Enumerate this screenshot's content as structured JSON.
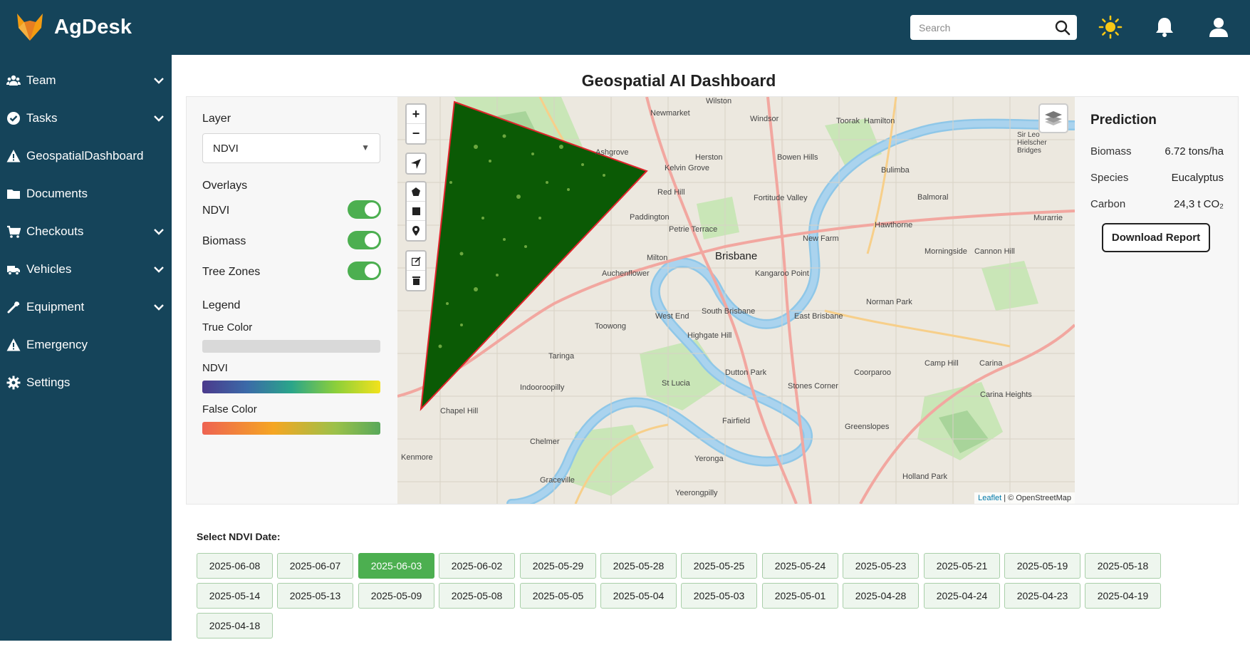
{
  "app": {
    "name": "AgDesk"
  },
  "header": {
    "search_placeholder": "Search",
    "icons": [
      "search-icon",
      "sun-icon",
      "bell-icon",
      "user-icon"
    ]
  },
  "sidebar": {
    "items": [
      {
        "label": "Team",
        "icon": "users-icon",
        "has_submenu": true
      },
      {
        "label": "Tasks",
        "icon": "check-circle-icon",
        "has_submenu": true
      },
      {
        "label": "GeospatialDashboard",
        "icon": "warning-icon",
        "has_submenu": false
      },
      {
        "label": "Documents",
        "icon": "folder-icon",
        "has_submenu": false
      },
      {
        "label": "Checkouts",
        "icon": "cart-icon",
        "has_submenu": true
      },
      {
        "label": "Vehicles",
        "icon": "truck-icon",
        "has_submenu": true
      },
      {
        "label": "Equipment",
        "icon": "wrench-icon",
        "has_submenu": true
      },
      {
        "label": "Emergency",
        "icon": "warning-icon",
        "has_submenu": false
      },
      {
        "label": "Settings",
        "icon": "gear-icon",
        "has_submenu": false
      }
    ]
  },
  "main": {
    "title": "Geospatial AI Dashboard"
  },
  "controls": {
    "layer_label": "Layer",
    "layer_value": "NDVI",
    "overlays_label": "Overlays",
    "overlays": [
      {
        "label": "NDVI",
        "on": true
      },
      {
        "label": "Biomass",
        "on": true
      },
      {
        "label": "Tree Zones",
        "on": true
      }
    ],
    "legend_label": "Legend",
    "legend": [
      {
        "label": "True Color"
      },
      {
        "label": "NDVI"
      },
      {
        "label": "False Color"
      }
    ]
  },
  "map": {
    "labels": {
      "wilston": "Wilston",
      "windsor": "Windsor",
      "newmarket": "Newmarket",
      "toorak": "Toorak",
      "hamilton": "Hamilton",
      "sir_leo": "Sir Leo Hielscher Bridges",
      "ashgrove": "Ashgrove",
      "herston": "Herston",
      "bowen_hills": "Bowen Hills",
      "kelvin_grove": "Kelvin Grove",
      "bulimba": "Bulimba",
      "red_hill": "Red Hill",
      "fortitude_valley": "Fortitude Valley",
      "balmoral": "Balmoral",
      "paddington": "Paddington",
      "murarrie": "Murarrie",
      "hawthorne": "Hawthorne",
      "petrie_terrace": "Petrie Terrace",
      "new_farm": "New Farm",
      "brisbane": "Brisbane",
      "morningside": "Morningside",
      "cannon_hill": "Cannon Hill",
      "milton": "Milton",
      "auchenflower": "Auchenflower",
      "kangaroo_point": "Kangaroo Point",
      "norman_park": "Norman Park",
      "south_brisbane": "South Brisbane",
      "west_end": "West End",
      "east_brisbane": "East Brisbane",
      "toowong": "Toowong",
      "highgate_hill": "Highgate Hill",
      "taringa": "Taringa",
      "camp_hill": "Camp Hill",
      "carina": "Carina",
      "dutton_park": "Dutton Park",
      "coorparoo": "Coorparoo",
      "indooroopilly": "Indooroopilly",
      "st_lucia": "St Lucia",
      "stones_corner": "Stones Corner",
      "carina_heights": "Carina Heights",
      "chapel_hill": "Chapel Hill",
      "fairfield": "Fairfield",
      "greenslopes": "Greenslopes",
      "chelmer": "Chelmer",
      "kenmore": "Kenmore",
      "yeronga": "Yeronga",
      "holland_park": "Holland Park",
      "graceville": "Graceville",
      "yeerongpilly": "Yeerongpilly"
    },
    "controls": [
      "zoom-in",
      "zoom-out",
      "locate",
      "draw-polygon",
      "draw-rectangle",
      "draw-marker",
      "edit-layers",
      "delete-layers"
    ],
    "attribution_leaflet": "Leaflet",
    "attribution_osm": "| © OpenStreetMap"
  },
  "prediction": {
    "title": "Prediction",
    "rows": [
      {
        "key": "Biomass",
        "value": "6.72 tons/ha"
      },
      {
        "key": "Species",
        "value": "Eucalyptus"
      },
      {
        "key": "Carbon",
        "value": "24,3 t CO₂"
      }
    ],
    "download_label": "Download Report"
  },
  "dates": {
    "title": "Select NDVI Date:",
    "selected": "2025-06-03",
    "items": [
      "2025-06-08",
      "2025-06-07",
      "2025-06-03",
      "2025-06-02",
      "2025-05-29",
      "2025-05-28",
      "2025-05-25",
      "2025-05-24",
      "2025-05-23",
      "2025-05-21",
      "2025-05-19",
      "2025-05-18",
      "2025-05-14",
      "2025-05-13",
      "2025-05-09",
      "2025-05-08",
      "2025-05-05",
      "2025-05-04",
      "2025-05-03",
      "2025-05-01",
      "2025-04-28",
      "2025-04-24",
      "2025-04-23",
      "2025-04-19",
      "2025-04-18"
    ]
  },
  "colors": {
    "header_bg": "#15445a",
    "accent_green": "#4caf50",
    "ndvi_overlay": "#0b5a05"
  }
}
